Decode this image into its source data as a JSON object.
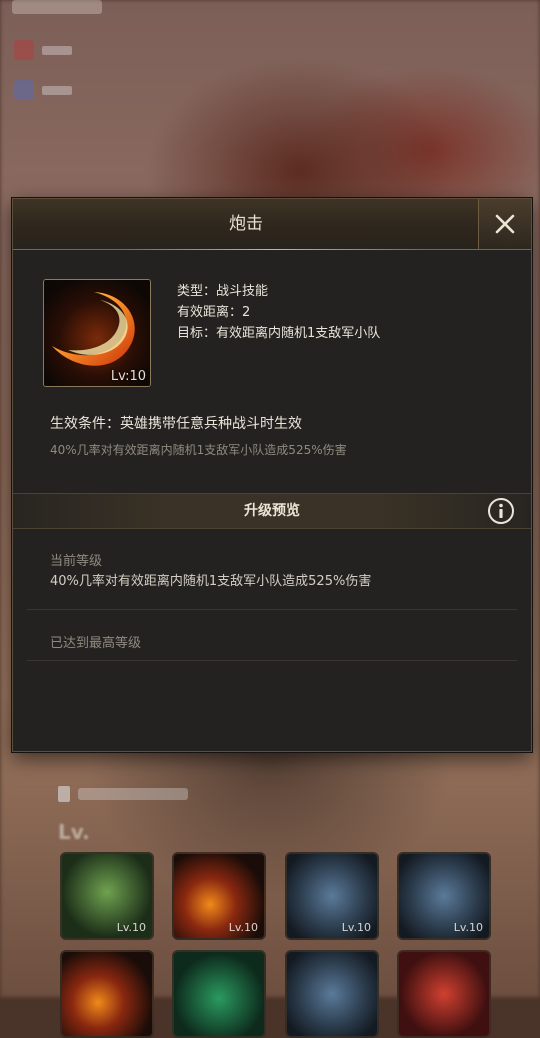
{
  "dialog": {
    "title": "炮击",
    "close_icon": "close-icon"
  },
  "skill": {
    "icon": "fire-slash-icon",
    "level": "Lv:10",
    "type_line": "类型：战斗技能",
    "range_line": "有效距离：2",
    "target_line": "目标：有效距离内随机1支敌军小队",
    "condition": "生效条件：英雄携带任意兵种战斗时生效",
    "description": "40%几率对有效距离内随机1支敌军小队造成525%伤害"
  },
  "upgrade_preview": {
    "title": "升级预览",
    "info_icon": "info-icon",
    "current_level_label": "当前等级",
    "current_level_desc": "40%几率对有效距离内随机1支敌军小队造成525%伤害",
    "max_level_text": "已达到最高等级"
  },
  "background": {
    "cards": [
      {
        "level": "Lv.10"
      },
      {
        "level": "Lv.10"
      },
      {
        "level": "Lv.10"
      },
      {
        "level": "Lv.10"
      }
    ]
  },
  "colors": {
    "panel": "#242220",
    "header_gold": "#7a6645",
    "text_main": "#e9e4da",
    "text_muted": "#8f8a80"
  }
}
